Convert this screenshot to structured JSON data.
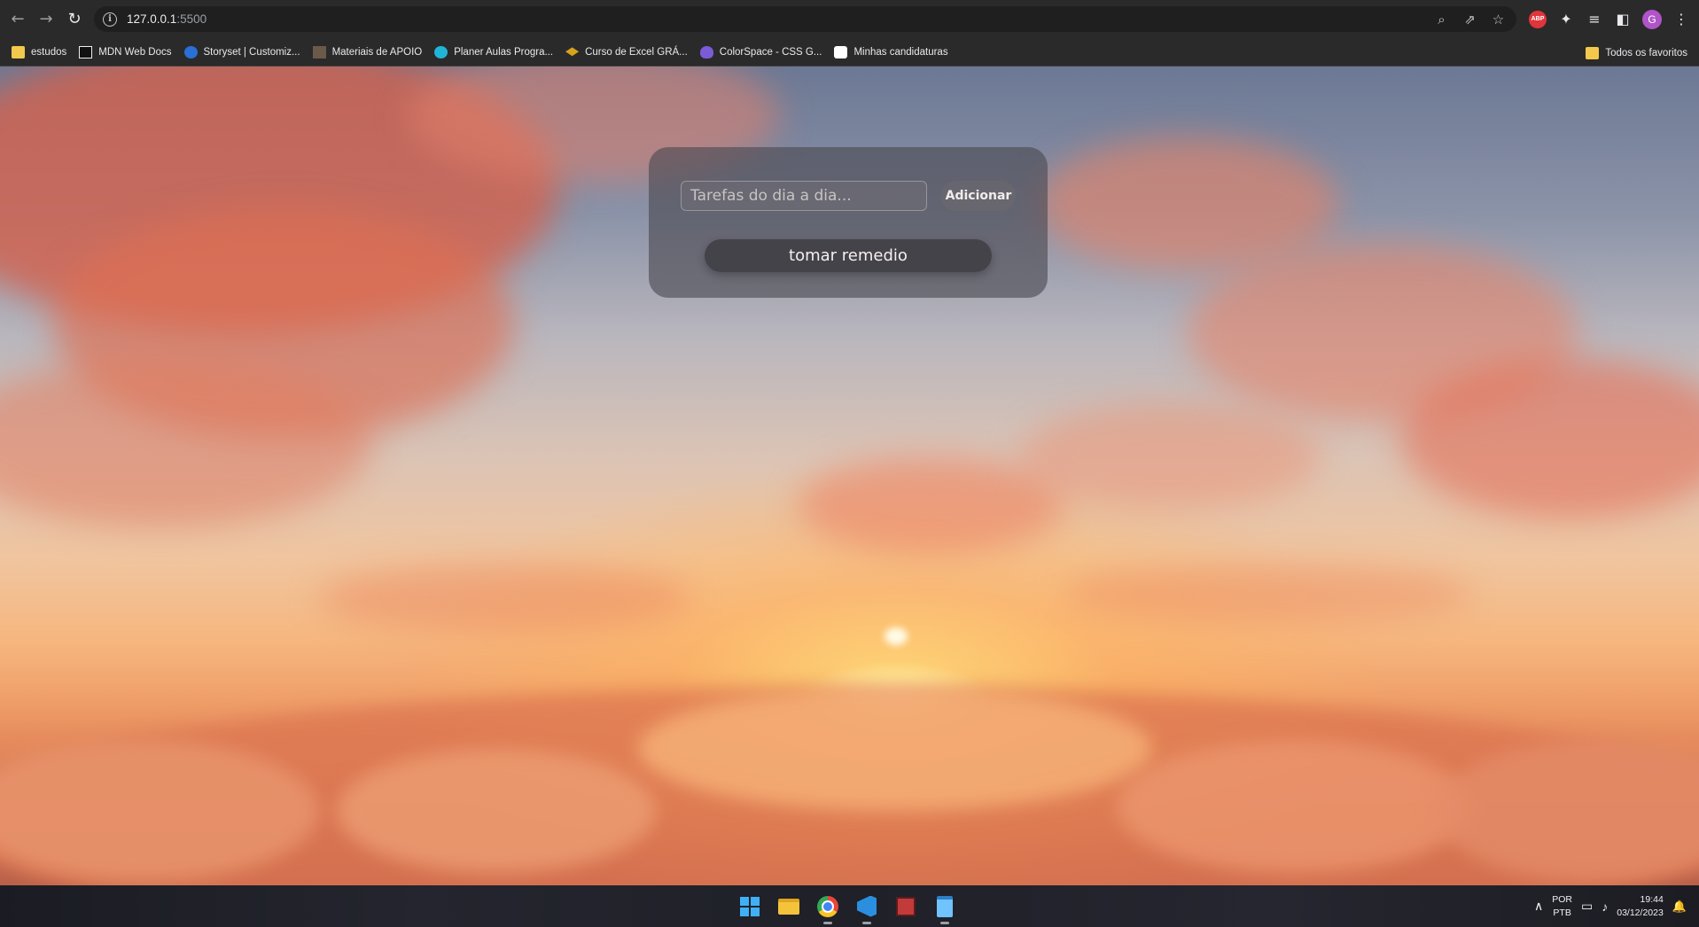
{
  "browser": {
    "nav": {
      "back_icon": "←",
      "forward_icon": "→",
      "reload_icon": "↻"
    },
    "address": {
      "host": "127.0.0.1",
      "port": ":5500"
    },
    "omnibox_actions": [
      "zoom-icon",
      "share-icon",
      "star-icon"
    ],
    "extensions": {
      "abp_label": "ABP",
      "avatar_initial": "G"
    },
    "bookmarks": [
      {
        "label": "estudos",
        "icon": "folder-icon"
      },
      {
        "label": "MDN Web Docs",
        "icon": "mdn-icon"
      },
      {
        "label": "Storyset | Customiz...",
        "icon": "storyset-icon"
      },
      {
        "label": "Materiais de APOIO",
        "icon": "apoio-icon"
      },
      {
        "label": "Planer Aulas Progra...",
        "icon": "canva-icon"
      },
      {
        "label": "Curso de Excel GRÁ...",
        "icon": "course-icon"
      },
      {
        "label": "ColorSpace - CSS G...",
        "icon": "colorspace-icon"
      },
      {
        "label": "Minhas candidaturas",
        "icon": "linkedin-icon"
      }
    ],
    "bookmarks_right": {
      "label": "Todos os favoritos",
      "icon": "folder-icon"
    }
  },
  "app": {
    "input_placeholder": "Tarefas do dia a dia...",
    "add_button_label": "Adicionar",
    "tasks": [
      {
        "text": "tomar remedio"
      }
    ]
  },
  "taskbar": {
    "apps": [
      "windows-start-icon",
      "file-explorer-icon",
      "chrome-icon",
      "vscode-icon",
      "app-icon",
      "notepad-icon"
    ],
    "tray": {
      "lang_top": "POR",
      "lang_bottom": "PTB",
      "time": "19:44",
      "date": "03/12/2023"
    }
  }
}
